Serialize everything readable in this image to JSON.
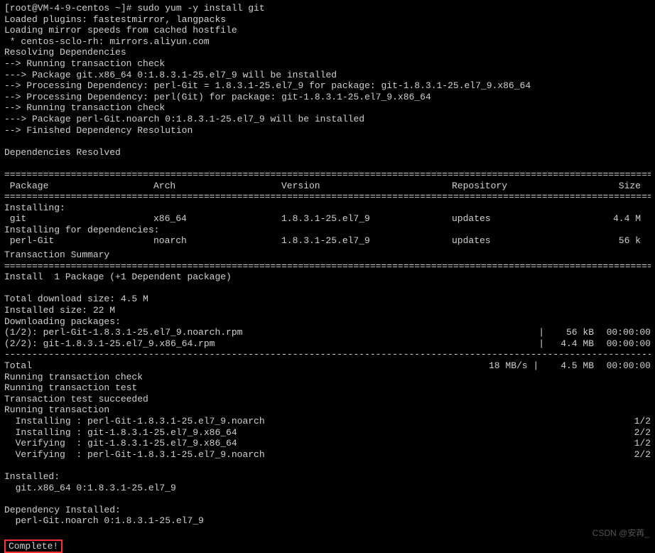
{
  "prompt": "[root@VM-4-9-centos ~]# sudo yum -y install git",
  "pre": [
    "Loaded plugins: fastestmirror, langpacks",
    "Loading mirror speeds from cached hostfile",
    " * centos-sclo-rh: mirrors.aliyun.com",
    "Resolving Dependencies",
    "--> Running transaction check",
    "---> Package git.x86_64 0:1.8.3.1-25.el7_9 will be installed",
    "--> Processing Dependency: perl-Git = 1.8.3.1-25.el7_9 for package: git-1.8.3.1-25.el7_9.x86_64",
    "--> Processing Dependency: perl(Git) for package: git-1.8.3.1-25.el7_9.x86_64",
    "--> Running transaction check",
    "---> Package perl-Git.noarch 0:1.8.3.1-25.el7_9 will be installed",
    "--> Finished Dependency Resolution",
    "",
    "Dependencies Resolved",
    ""
  ],
  "table": {
    "headers": {
      "pkg": " Package",
      "arch": "Arch",
      "ver": "Version",
      "repo": "Repository",
      "size": "Size"
    },
    "sections": [
      {
        "title": "Installing:",
        "rows": [
          {
            "pkg": " git",
            "arch": "x86_64",
            "ver": "1.8.3.1-25.el7_9",
            "repo": "updates",
            "size": "4.4 M"
          }
        ]
      },
      {
        "title": "Installing for dependencies:",
        "rows": [
          {
            "pkg": " perl-Git",
            "arch": "noarch",
            "ver": "1.8.3.1-25.el7_9",
            "repo": "updates",
            "size": "56 k"
          }
        ]
      }
    ]
  },
  "summary_title": "Transaction Summary",
  "summary_line": "Install  1 Package (+1 Dependent package)",
  "sizes": [
    "Total download size: 4.5 M",
    "Installed size: 22 M",
    "Downloading packages:"
  ],
  "downloads": [
    {
      "left": "(1/2): perl-Git-1.8.3.1-25.el7_9.noarch.rpm",
      "sep": "|",
      "size": " 56 kB",
      "time": "00:00:00"
    },
    {
      "left": "(2/2): git-1.8.3.1-25.el7_9.x86_64.rpm",
      "sep": "|",
      "size": "4.4 MB",
      "time": "00:00:00"
    }
  ],
  "total": {
    "left": "Total",
    "rate": "18 MB/s",
    "sep": " | ",
    "size": "4.5 MB",
    "time": "00:00:00"
  },
  "post_total": [
    "Running transaction check",
    "Running transaction test",
    "Transaction test succeeded",
    "Running transaction"
  ],
  "tx": [
    {
      "left": "  Installing : perl-Git-1.8.3.1-25.el7_9.noarch",
      "right": "1/2"
    },
    {
      "left": "  Installing : git-1.8.3.1-25.el7_9.x86_64",
      "right": "2/2"
    },
    {
      "left": "  Verifying  : git-1.8.3.1-25.el7_9.x86_64",
      "right": "1/2"
    },
    {
      "left": "  Verifying  : perl-Git-1.8.3.1-25.el7_9.noarch",
      "right": "2/2"
    }
  ],
  "installed_header": "Installed:",
  "installed_line": "  git.x86_64 0:1.8.3.1-25.el7_9",
  "dep_header": "Dependency Installed:",
  "dep_line": "  perl-Git.noarch 0:1.8.3.1-25.el7_9",
  "complete": "Complete!",
  "watermark": "CSDN @安苒_",
  "rules": {
    "dbl": "=================================================================================================================================",
    "dsh": "---------------------------------------------------------------------------------------------------------------------------------"
  }
}
